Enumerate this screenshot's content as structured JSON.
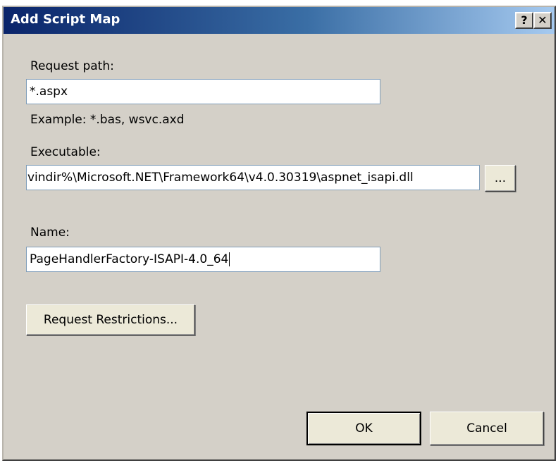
{
  "window": {
    "title": "Add Script Map",
    "help_label": "?",
    "close_label": "✕"
  },
  "form": {
    "request_path": {
      "label": "Request path:",
      "value": "*.aspx",
      "example": "Example: *.bas, wsvc.axd"
    },
    "executable": {
      "label": "Executable:",
      "value": "vindir%\\Microsoft.NET\\Framework64\\v4.0.30319\\aspnet_isapi.dll",
      "browse_label": "..."
    },
    "name": {
      "label": "Name:",
      "value": "PageHandlerFactory-ISAPI-4.0_64"
    },
    "request_restrictions_label": "Request Restrictions..."
  },
  "footer": {
    "ok_label": "OK",
    "cancel_label": "Cancel"
  }
}
